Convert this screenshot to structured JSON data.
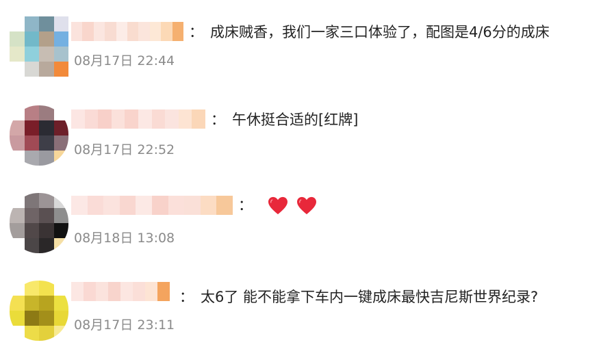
{
  "comments": [
    {
      "separator": "：",
      "text": "成床贼香，我们一家三口体验了，配图是4/6分的成床",
      "time": "08月17日 22:44"
    },
    {
      "separator": "：",
      "text": "午休挺合适的[红牌]",
      "time": "08月17日 22:52"
    },
    {
      "separator": "：",
      "text": "",
      "emoji": [
        "heart-icon",
        "heart-icon"
      ],
      "time": "08月18日 13:08"
    },
    {
      "separator": "：",
      "text": "太6了 能不能拿下车内一键成床最快吉尼斯世界纪录?",
      "time": "08月17日 23:11"
    }
  ],
  "colors": {
    "timestamp": "#8a8a8a",
    "text": "#222222",
    "heart": "#e8283a"
  }
}
